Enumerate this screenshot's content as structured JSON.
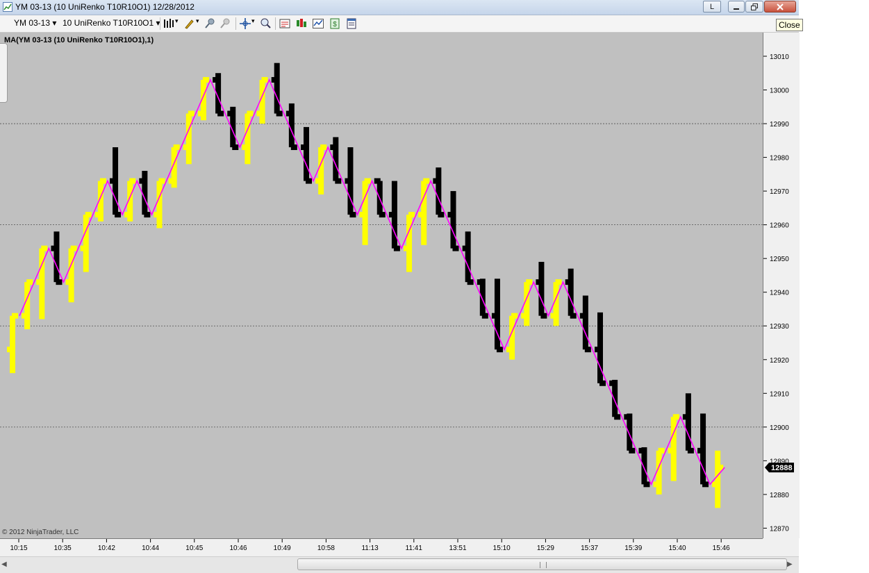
{
  "window": {
    "title": "YM 03-13 (10 UniRenko T10R10O1)  12/28/2012",
    "layout_button": "L",
    "close_tooltip": "Close"
  },
  "toolbar": {
    "instrument": "YM 03-13",
    "bar_type": "10 UniRenko T10R10O1",
    "icons": [
      "bar-type-icon",
      "drawing-tool-icon",
      "pin-icon",
      "pin-disabled-icon",
      "crosshair-icon",
      "zoom-icon",
      "data-box-icon",
      "chart-style-icon",
      "indicators-icon",
      "strategies-icon",
      "properties-icon"
    ]
  },
  "chart": {
    "indicator_label": "MA(YM 03-13 (10 UniRenko T10R10O1),1)",
    "copyright": "© 2012 NinjaTrader, LLC",
    "last_price": "12888",
    "price_ticks": [
      "13010",
      "13000",
      "12990",
      "12980",
      "12970",
      "12960",
      "12950",
      "12940",
      "12930",
      "12920",
      "12910",
      "12900",
      "12890",
      "12880",
      "12870"
    ],
    "time_ticks": [
      "10:15",
      "10:35",
      "10:42",
      "10:44",
      "10:45",
      "10:46",
      "10:49",
      "10:58",
      "11:13",
      "11:41",
      "13:51",
      "15:10",
      "15:29",
      "15:37",
      "15:39",
      "15:40",
      "15:46"
    ],
    "colors": {
      "background": "#c0c0c0",
      "up_bar": "#ffff00",
      "down_bar": "#000000",
      "ma_line": "#ff00ff"
    }
  },
  "chart_data": {
    "type": "line",
    "title": "",
    "xlabel": "",
    "ylabel": "",
    "ylim": [
      12867,
      13017
    ],
    "grid": "horizontal dotted lines every 30 points",
    "x_ticks": [
      "10:15",
      "10:35",
      "10:42",
      "10:44",
      "10:45",
      "10:46",
      "10:49",
      "10:58",
      "11:13",
      "11:41",
      "13:51",
      "15:10",
      "15:29",
      "15:37",
      "15:39",
      "15:40",
      "15:46"
    ],
    "y_ticks": [
      12870,
      12880,
      12890,
      12900,
      12910,
      12920,
      12930,
      12940,
      12950,
      12960,
      12970,
      12980,
      12990,
      13000,
      13010
    ],
    "series": [
      {
        "values": [
          12933,
          12943,
          12953,
          12943,
          12953,
          12963,
          12973,
          12963,
          12973,
          12963,
          12973,
          12983,
          12993,
          13003,
          12993,
          12983,
          12993,
          13003,
          12993,
          12983,
          12973,
          12983,
          12973,
          12963,
          12973,
          12963,
          12953,
          12963,
          12973,
          12963,
          12953,
          12943,
          12933,
          12923,
          12933,
          12943,
          12933,
          12943,
          12933,
          12923,
          12913,
          12903,
          12893,
          12883,
          12893,
          12903,
          12893,
          12883,
          12888
        ]
      }
    ],
    "bars": [
      {
        "d": "u",
        "o": 12923,
        "c": 12933,
        "h": 12933,
        "l": 12916
      },
      {
        "d": "u",
        "o": 12933,
        "c": 12943,
        "h": 12943,
        "l": 12929
      },
      {
        "d": "u",
        "o": 12943,
        "c": 12953,
        "h": 12953,
        "l": 12932
      },
      {
        "d": "d",
        "o": 12953,
        "c": 12943,
        "h": 12958,
        "l": 12943
      },
      {
        "d": "u",
        "o": 12943,
        "c": 12953,
        "h": 12953,
        "l": 12937
      },
      {
        "d": "u",
        "o": 12953,
        "c": 12963,
        "h": 12963,
        "l": 12946
      },
      {
        "d": "u",
        "o": 12963,
        "c": 12973,
        "h": 12973,
        "l": 12961
      },
      {
        "d": "d",
        "o": 12973,
        "c": 12963,
        "h": 12983,
        "l": 12963
      },
      {
        "d": "u",
        "o": 12963,
        "c": 12973,
        "h": 12973,
        "l": 12961
      },
      {
        "d": "d",
        "o": 12973,
        "c": 12963,
        "h": 12976,
        "l": 12963
      },
      {
        "d": "u",
        "o": 12963,
        "c": 12973,
        "h": 12973,
        "l": 12959
      },
      {
        "d": "u",
        "o": 12973,
        "c": 12983,
        "h": 12983,
        "l": 12971
      },
      {
        "d": "u",
        "o": 12983,
        "c": 12993,
        "h": 12993,
        "l": 12978
      },
      {
        "d": "u",
        "o": 12993,
        "c": 13003,
        "h": 13003,
        "l": 12991
      },
      {
        "d": "d",
        "o": 13003,
        "c": 12993,
        "h": 13005,
        "l": 12993
      },
      {
        "d": "d",
        "o": 12993,
        "c": 12983,
        "h": 12995,
        "l": 12983
      },
      {
        "d": "u",
        "o": 12983,
        "c": 12993,
        "h": 12993,
        "l": 12978
      },
      {
        "d": "u",
        "o": 12993,
        "c": 13003,
        "h": 13003,
        "l": 12990
      },
      {
        "d": "d",
        "o": 13003,
        "c": 12993,
        "h": 13008,
        "l": 12993
      },
      {
        "d": "d",
        "o": 12993,
        "c": 12983,
        "h": 12996,
        "l": 12983
      },
      {
        "d": "d",
        "o": 12983,
        "c": 12973,
        "h": 12989,
        "l": 12973
      },
      {
        "d": "u",
        "o": 12973,
        "c": 12983,
        "h": 12983,
        "l": 12969
      },
      {
        "d": "d",
        "o": 12983,
        "c": 12973,
        "h": 12986,
        "l": 12973
      },
      {
        "d": "d",
        "o": 12973,
        "c": 12963,
        "h": 12983,
        "l": 12963
      },
      {
        "d": "u",
        "o": 12963,
        "c": 12973,
        "h": 12973,
        "l": 12954
      },
      {
        "d": "d",
        "o": 12973,
        "c": 12963,
        "h": 12973,
        "l": 12963
      },
      {
        "d": "d",
        "o": 12963,
        "c": 12953,
        "h": 12973,
        "l": 12953
      },
      {
        "d": "u",
        "o": 12953,
        "c": 12963,
        "h": 12963,
        "l": 12946
      },
      {
        "d": "u",
        "o": 12963,
        "c": 12973,
        "h": 12973,
        "l": 12954
      },
      {
        "d": "d",
        "o": 12973,
        "c": 12963,
        "h": 12977,
        "l": 12963
      },
      {
        "d": "d",
        "o": 12963,
        "c": 12953,
        "h": 12970,
        "l": 12953
      },
      {
        "d": "d",
        "o": 12953,
        "c": 12943,
        "h": 12958,
        "l": 12943
      },
      {
        "d": "d",
        "o": 12943,
        "c": 12933,
        "h": 12944,
        "l": 12933
      },
      {
        "d": "d",
        "o": 12933,
        "c": 12923,
        "h": 12944,
        "l": 12923
      },
      {
        "d": "u",
        "o": 12923,
        "c": 12933,
        "h": 12933,
        "l": 12920
      },
      {
        "d": "u",
        "o": 12933,
        "c": 12943,
        "h": 12943,
        "l": 12930
      },
      {
        "d": "d",
        "o": 12943,
        "c": 12933,
        "h": 12949,
        "l": 12933
      },
      {
        "d": "u",
        "o": 12933,
        "c": 12943,
        "h": 12943,
        "l": 12930
      },
      {
        "d": "d",
        "o": 12943,
        "c": 12933,
        "h": 12947,
        "l": 12933
      },
      {
        "d": "d",
        "o": 12933,
        "c": 12923,
        "h": 12939,
        "l": 12923
      },
      {
        "d": "d",
        "o": 12923,
        "c": 12913,
        "h": 12934,
        "l": 12913
      },
      {
        "d": "d",
        "o": 12913,
        "c": 12903,
        "h": 12914,
        "l": 12903
      },
      {
        "d": "d",
        "o": 12903,
        "c": 12893,
        "h": 12904,
        "l": 12893
      },
      {
        "d": "d",
        "o": 12893,
        "c": 12883,
        "h": 12894,
        "l": 12883
      },
      {
        "d": "u",
        "o": 12883,
        "c": 12893,
        "h": 12893,
        "l": 12880
      },
      {
        "d": "u",
        "o": 12893,
        "c": 12903,
        "h": 12903,
        "l": 12884
      },
      {
        "d": "d",
        "o": 12903,
        "c": 12893,
        "h": 12910,
        "l": 12893
      },
      {
        "d": "d",
        "o": 12893,
        "c": 12883,
        "h": 12904,
        "l": 12883
      },
      {
        "d": "u",
        "o": 12883,
        "c": 12888,
        "h": 12893,
        "l": 12876
      }
    ]
  }
}
